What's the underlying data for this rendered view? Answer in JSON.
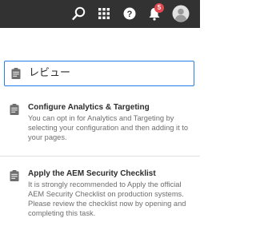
{
  "topbar": {
    "icons": [
      "search-icon",
      "apps-grid-icon",
      "help-icon",
      "bell-icon",
      "user-avatar-icon"
    ],
    "notification_count": "5",
    "colors": {
      "background": "#323232",
      "icon": "#ffffff",
      "badge": "#e34850"
    }
  },
  "search": {
    "value": "レビュー",
    "accent": "#2680eb"
  },
  "results": [
    {
      "title": "Configure Analytics & Targeting",
      "description": "You can opt in for Analytics and Targeting by selecting your configuration and then adding it to your pages."
    },
    {
      "title": "Apply the AEM Security Checklist",
      "description": "It is strongly recommended to Apply the official AEM Security Checklist on production systems. Please review the checklist now by opening and completing this task."
    }
  ]
}
